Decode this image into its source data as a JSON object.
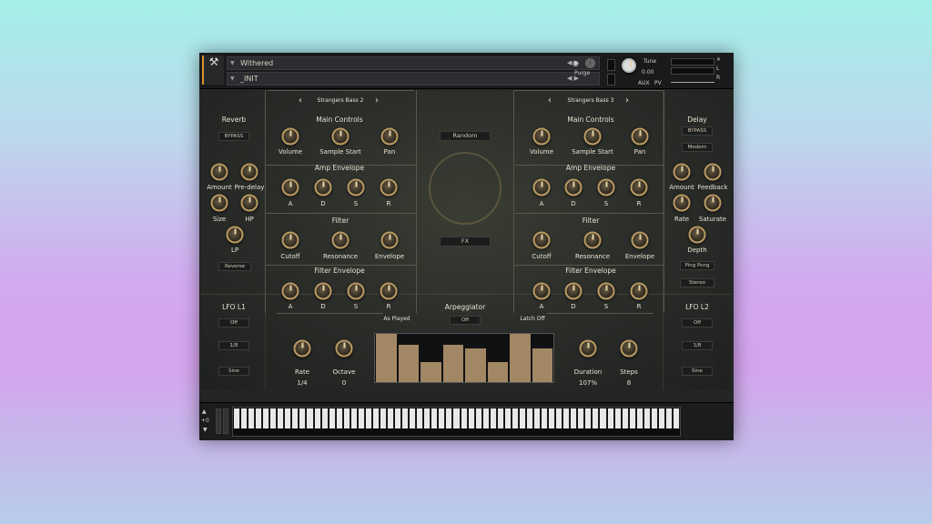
{
  "header": {
    "instrument": "Withered",
    "preset": "_INIT",
    "purge": "Purge",
    "tune_label": "Tune",
    "tune_value": "0.00",
    "left": "L",
    "right": "R",
    "aux": "AUX",
    "pv": "PV"
  },
  "labels": {
    "browser_left": "Strangers Bass 2",
    "browser_right": "Strangers Bass 3",
    "main_controls": "Main Controls",
    "volume": "Volume",
    "sample_start": "Sample Start",
    "pan": "Pan",
    "amp_envelope": "Amp Envelope",
    "filter": "Filter",
    "filter_envelope": "Filter Envelope",
    "a": "A",
    "d": "D",
    "s": "S",
    "r": "R",
    "cutoff": "Cutoff",
    "resonance": "Resonance",
    "envelope": "Envelope",
    "reverb": "Reverb",
    "bypass": "BYPASS",
    "amount": "Amount",
    "predelay": "Pre-delay",
    "size": "Size",
    "hp": "HP",
    "lp": "LP",
    "reverse": "Reverse",
    "delay": "Delay",
    "modern": "Modern",
    "feedback": "Feedback",
    "rate": "Rate",
    "saturate": "Saturate",
    "depth": "Depth",
    "ping_pong": "Ping Pong",
    "stereo": "Stereo",
    "random": "Random",
    "fx": "FX",
    "lfo_l1": "LFO L1",
    "lfo_l2": "LFO L2",
    "off": "Off",
    "div": "1/8",
    "sine": "Sine",
    "arpeggiator": "Arpeggiator",
    "arp_played": "As Played",
    "latch": "Latch Off",
    "octave": "Octave",
    "duration": "Duration",
    "steps": "Steps",
    "rate_value": "1/4",
    "octave_value": "0",
    "duration_value": "107%",
    "steps_value": "8",
    "kb_plus": "+0",
    "kb_minus": "–"
  },
  "arp_steps": [
    1.0,
    0.78,
    0.42,
    0.78,
    0.7,
    0.42,
    1.0,
    0.7
  ],
  "colors": {
    "accent": "#b99a62",
    "bar": "#a28764"
  }
}
